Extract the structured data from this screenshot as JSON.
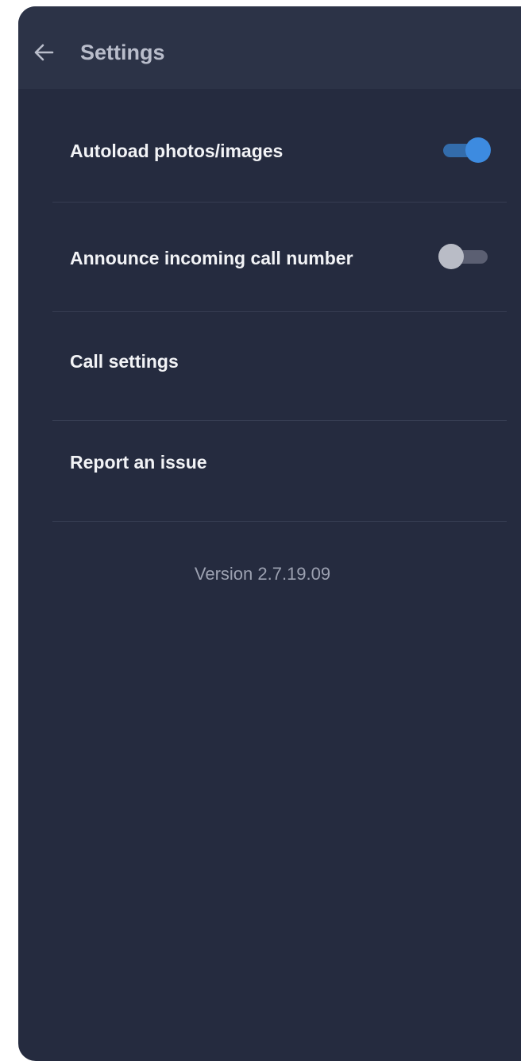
{
  "header": {
    "title": "Settings",
    "back_icon": "arrow-left-icon"
  },
  "settings": {
    "autoload": {
      "label": "Autoload photos/images",
      "enabled": true
    },
    "announce": {
      "label": "Announce incoming call number",
      "enabled": false
    },
    "call_settings": {
      "label": "Call settings"
    },
    "report_issue": {
      "label": "Report an issue"
    }
  },
  "footer": {
    "version": "Version 2.7.19.09"
  },
  "colors": {
    "panel_bg": "#252b3f",
    "header_bg": "#2c3347",
    "accent": "#3d8be0",
    "divider": "#363d52"
  }
}
